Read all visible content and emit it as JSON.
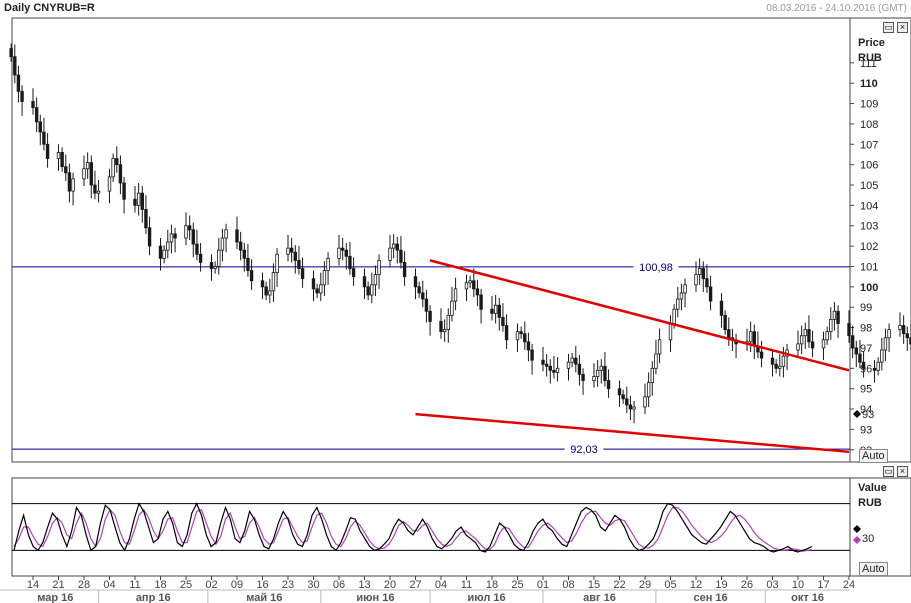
{
  "header": {
    "title": "Daily CNYRUB=R",
    "range": "08.03.2016 - 24.10.2016 (GMT)"
  },
  "price_panel": {
    "label1": "Price",
    "label2": "RUB",
    "auto_label": "Auto",
    "last_marker": "93"
  },
  "osc_panel": {
    "label1": "Value",
    "label2": "RUB",
    "auto_label": "Auto",
    "tick": "30"
  },
  "colors": {
    "candle": "#1a1a1a",
    "hline": "#00008b",
    "trend": "#e00000",
    "osc_k": "#000000",
    "osc_d": "#b040c0"
  },
  "chart_data": [
    {
      "type": "candlestick",
      "title": "Daily CNYRUB=R",
      "ylabel": "Price RUB",
      "ylim": [
        91.4,
        113.2
      ],
      "y_ticks": [
        92,
        93,
        94,
        95,
        96,
        97,
        98,
        99,
        100,
        101,
        102,
        103,
        104,
        105,
        106,
        107,
        108,
        109,
        110,
        111
      ],
      "y_ticks_bold": [
        100,
        110
      ],
      "x_tick_labels": [
        "14",
        "21",
        "28",
        "04",
        "11",
        "18",
        "25",
        "02",
        "09",
        "16",
        "23",
        "30",
        "06",
        "13",
        "20",
        "27",
        "04",
        "11",
        "18",
        "25",
        "01",
        "08",
        "15",
        "22",
        "29",
        "05",
        "12",
        "19",
        "26",
        "03",
        "10",
        "17",
        "24"
      ],
      "x_month_labels": [
        "мар 16",
        "апр 16",
        "май 16",
        "июн 16",
        "июл 16",
        "авг 16",
        "сен 16",
        "окт 16"
      ],
      "closes": [
        111.3,
        110.4,
        109.6,
        109.1,
        108.8,
        108.1,
        107.6,
        107.0,
        106.3,
        106.6,
        105.9,
        105.6,
        104.7,
        105.3,
        105.8,
        106.1,
        105.0,
        104.6,
        104.7,
        105.4,
        106.3,
        106.0,
        105.1,
        104.3,
        104.0,
        104.6,
        103.8,
        102.9,
        102.0,
        101.4,
        101.8,
        102.2,
        102.6,
        102.4,
        103.0,
        102.8,
        102.1,
        101.6,
        101.2,
        100.9,
        101.0,
        101.8,
        102.4,
        102.8,
        102.2,
        101.8,
        101.4,
        100.8,
        100.3,
        100.0,
        99.6,
        99.8,
        100.7,
        101.6,
        101.9,
        101.7,
        101.3,
        100.9,
        100.4,
        99.9,
        99.7,
        100.1,
        100.8,
        101.4,
        101.9,
        101.8,
        101.5,
        100.9,
        100.5,
        100.0,
        99.6,
        100.1,
        100.6,
        101.3,
        101.9,
        102.1,
        101.8,
        101.2,
        100.5,
        100.0,
        99.7,
        99.4,
        98.8,
        98.3,
        97.8,
        97.9,
        98.6,
        99.3,
        99.9,
        100.2,
        100.3,
        99.9,
        99.6,
        98.9,
        98.7,
        99.1,
        98.5,
        98.1,
        97.4,
        97.8,
        97.7,
        97.3,
        96.9,
        96.4,
        96.2,
        96.1,
        95.9,
        95.8,
        96.0,
        96.3,
        96.5,
        96.2,
        95.7,
        95.4,
        95.6,
        95.9,
        96.1,
        95.4,
        95.0,
        94.7,
        94.5,
        94.2,
        94.0,
        94.1,
        94.6,
        95.3,
        96.0,
        96.7,
        97.4,
        98.2,
        98.9,
        99.4,
        99.7,
        100.1,
        100.6,
        100.9,
        100.4,
        100.0,
        99.3,
        98.6,
        97.9,
        97.5,
        97.4,
        97.2,
        97.3,
        97.8,
        97.1,
        96.8,
        96.5,
        96.2,
        96.0,
        96.1,
        96.6,
        96.9,
        97.2,
        97.6,
        97.9,
        97.3,
        97.0,
        97.4,
        97.8,
        98.4,
        98.8,
        98.2,
        97.6,
        97.0,
        96.7,
        96.3,
        96.0,
        95.9,
        96.3,
        96.9,
        97.5,
        97.9,
        98.1,
        97.7,
        97.5,
        97.2,
        97.0,
        96.7,
        96.3,
        95.8,
        95.5,
        95.4,
        95.8,
        96.0,
        95.4,
        95.0,
        94.6,
        94.2,
        93.9,
        93.7,
        93.5,
        93.3,
        93.1,
        93.2,
        93.3,
        93.1
      ],
      "series": [
        {
          "name": "",
          "type": "hline",
          "value": 100.98,
          "label": "100,98"
        },
        {
          "name": "",
          "type": "hline",
          "value": 92.03,
          "label": "92,03"
        },
        {
          "name": "",
          "type": "trendline",
          "points": [
            [
              "2016-07-01",
              101.3
            ],
            [
              "2016-10-24",
              95.9
            ]
          ]
        },
        {
          "name": "",
          "type": "trendline",
          "points": [
            [
              "2016-06-27",
              93.75
            ],
            [
              "2016-10-24",
              91.9
            ]
          ]
        }
      ]
    },
    {
      "type": "line",
      "ylabel": "Value RUB",
      "y_ticks": [
        30
      ],
      "ylim": [
        0,
        100
      ],
      "levels": [
        20,
        80
      ],
      "k": [
        20,
        45,
        65,
        40,
        25,
        20,
        30,
        50,
        68,
        60,
        40,
        25,
        45,
        75,
        65,
        40,
        20,
        25,
        55,
        78,
        72,
        50,
        30,
        20,
        35,
        60,
        80,
        70,
        50,
        30,
        35,
        60,
        70,
        55,
        30,
        25,
        40,
        68,
        80,
        65,
        40,
        25,
        30,
        55,
        75,
        60,
        35,
        30,
        45,
        70,
        60,
        40,
        25,
        22,
        35,
        55,
        70,
        60,
        40,
        28,
        25,
        40,
        65,
        75,
        60,
        40,
        25,
        20,
        30,
        45,
        62,
        60,
        45,
        35,
        25,
        20,
        22,
        28,
        35,
        50,
        60,
        55,
        45,
        40,
        50,
        60,
        50,
        35,
        25,
        22,
        28,
        35,
        45,
        50,
        40,
        35,
        30,
        20,
        18,
        25,
        40,
        55,
        50,
        40,
        28,
        22,
        20,
        30,
        45,
        55,
        60,
        50,
        45,
        35,
        28,
        25,
        40,
        55,
        70,
        75,
        72,
        65,
        50,
        45,
        55,
        65,
        60,
        50,
        35,
        25,
        20,
        22,
        28,
        35,
        50,
        70,
        80,
        78,
        70,
        60,
        50,
        40,
        35,
        30,
        28,
        35,
        42,
        50,
        60,
        70,
        65,
        55,
        45,
        35,
        30,
        28,
        25,
        20,
        18,
        20,
        22,
        25,
        20,
        18,
        20,
        22,
        25
      ],
      "d": [
        25,
        35,
        50,
        50,
        38,
        28,
        25,
        38,
        55,
        62,
        55,
        40,
        35,
        55,
        68,
        55,
        35,
        25,
        35,
        60,
        72,
        65,
        45,
        30,
        28,
        45,
        65,
        72,
        62,
        45,
        35,
        45,
        60,
        62,
        45,
        30,
        30,
        50,
        70,
        72,
        55,
        38,
        28,
        38,
        60,
        68,
        50,
        35,
        38,
        55,
        62,
        50,
        35,
        28,
        30,
        45,
        60,
        62,
        50,
        38,
        30,
        32,
        50,
        65,
        68,
        55,
        38,
        28,
        25,
        35,
        50,
        58,
        52,
        42,
        32,
        25,
        22,
        23,
        28,
        38,
        52,
        57,
        52,
        45,
        45,
        52,
        55,
        45,
        35,
        28,
        25,
        28,
        36,
        43,
        45,
        40,
        35,
        28,
        22,
        21,
        28,
        42,
        50,
        48,
        38,
        30,
        24,
        24,
        34,
        45,
        52,
        55,
        50,
        43,
        36,
        30,
        32,
        42,
        55,
        65,
        70,
        70,
        62,
        55,
        52,
        58,
        60,
        58,
        48,
        38,
        28,
        24,
        23,
        27,
        35,
        50,
        65,
        75,
        75,
        70,
        62,
        52,
        45,
        38,
        33,
        30,
        33,
        38,
        45,
        55,
        63,
        65,
        60,
        52,
        43,
        36,
        31,
        27,
        23,
        21,
        20,
        21,
        22,
        21,
        19,
        20,
        21
      ]
    }
  ]
}
